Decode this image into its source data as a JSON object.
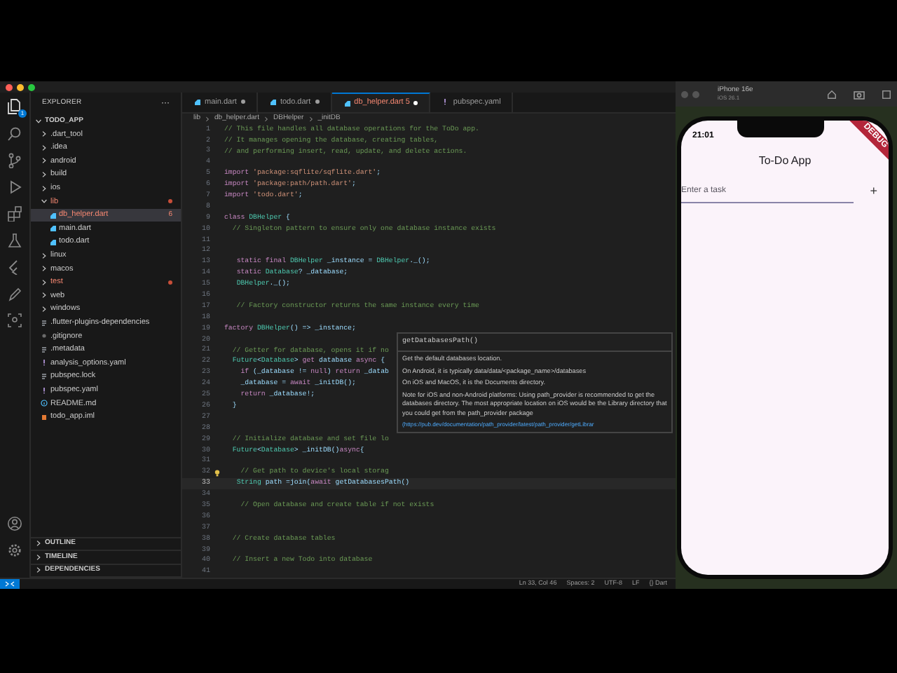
{
  "activity_bar": {
    "badge": "1"
  },
  "explorer": {
    "title": "EXPLORER",
    "more": "···",
    "root": "TODO_APP",
    "items": [
      {
        "label": ".dart_tool",
        "kind": "folder",
        "expanded": false,
        "selected": false,
        "error": false
      },
      {
        "label": ".idea",
        "kind": "folder",
        "expanded": false,
        "selected": false,
        "error": false
      },
      {
        "label": "android",
        "kind": "folder",
        "expanded": false,
        "selected": false,
        "error": false
      },
      {
        "label": "build",
        "kind": "folder",
        "expanded": false,
        "selected": false,
        "error": false
      },
      {
        "label": "ios",
        "kind": "folder",
        "expanded": false,
        "selected": false,
        "error": false
      },
      {
        "label": "lib",
        "kind": "folder",
        "expanded": true,
        "selected": false,
        "error": true,
        "children": [
          {
            "label": "db_helper.dart",
            "kind": "dart",
            "selected": true,
            "error": true,
            "badge": "6"
          },
          {
            "label": "main.dart",
            "kind": "dart",
            "selected": false,
            "error": false
          },
          {
            "label": "todo.dart",
            "kind": "dart",
            "selected": false,
            "error": false
          }
        ]
      },
      {
        "label": "linux",
        "kind": "folder",
        "expanded": false,
        "selected": false,
        "error": false
      },
      {
        "label": "macos",
        "kind": "folder",
        "expanded": false,
        "selected": false,
        "error": false
      },
      {
        "label": "test",
        "kind": "folder",
        "expanded": false,
        "selected": false,
        "error": true
      },
      {
        "label": "web",
        "kind": "folder",
        "expanded": false,
        "selected": false,
        "error": false
      },
      {
        "label": "windows",
        "kind": "folder",
        "expanded": false,
        "selected": false,
        "error": false
      },
      {
        "label": ".flutter-plugins-dependencies",
        "kind": "text",
        "selected": false,
        "error": false
      },
      {
        "label": ".gitignore",
        "kind": "git",
        "selected": false,
        "error": false
      },
      {
        "label": ".metadata",
        "kind": "text",
        "selected": false,
        "error": false
      },
      {
        "label": "analysis_options.yaml",
        "kind": "yaml",
        "selected": false,
        "error": false
      },
      {
        "label": "pubspec.lock",
        "kind": "text",
        "selected": false,
        "error": false
      },
      {
        "label": "pubspec.yaml",
        "kind": "yaml",
        "selected": false,
        "error": false
      },
      {
        "label": "README.md",
        "kind": "info",
        "selected": false,
        "error": false
      },
      {
        "label": "todo_app.iml",
        "kind": "iml",
        "selected": false,
        "error": false
      }
    ]
  },
  "sections": [
    "OUTLINE",
    "TIMELINE",
    "DEPENDENCIES"
  ],
  "tabs": [
    {
      "label": "main.dart",
      "selected": false,
      "modified": true
    },
    {
      "label": "todo.dart",
      "selected": false,
      "modified": true
    },
    {
      "label": "db_helper.dart",
      "badge": "5",
      "selected": true,
      "modified": true
    },
    {
      "label": "pubspec.yaml",
      "selected": false,
      "modified": false
    }
  ],
  "breadcrumbs": [
    "lib",
    "db_helper.dart",
    "DBHelper",
    "_initDB"
  ],
  "code_lines": [
    {
      "n": "1",
      "kind": "comment",
      "text": "// This file handles all database operations for the ToDo app."
    },
    {
      "n": "2",
      "kind": "comment",
      "text": "// It manages opening the database, creating tables,"
    },
    {
      "n": "3",
      "kind": "comment",
      "text": "// and performing insert, read, update, and delete actions."
    },
    {
      "n": "4",
      "kind": "blank"
    },
    {
      "n": "5",
      "kind": "code",
      "text": "import 'package:sqflite/sqflite.dart';"
    },
    {
      "n": "6",
      "kind": "code",
      "text": "import 'package:path/path.dart';"
    },
    {
      "n": "7",
      "kind": "code",
      "text": "import 'todo.dart';"
    },
    {
      "n": "8",
      "kind": "blank"
    },
    {
      "n": "9",
      "kind": "code",
      "text": "class DBHelper {"
    },
    {
      "n": "10",
      "kind": "comment",
      "text": "  // Singleton pattern to ensure only one database instance exists"
    },
    {
      "n": "11",
      "kind": "blank"
    },
    {
      "n": "12",
      "kind": "blank"
    },
    {
      "n": "13",
      "kind": "code",
      "text": "   static final DBHelper _instance = DBHelper._();"
    },
    {
      "n": "14",
      "kind": "code",
      "text": "   static Database? _database;"
    },
    {
      "n": "15",
      "kind": "code",
      "text": "   DBHelper._();"
    },
    {
      "n": "16",
      "kind": "blank"
    },
    {
      "n": "17",
      "kind": "comment",
      "text": "   // Factory constructor returns the same instance every time"
    },
    {
      "n": "18",
      "kind": "blank"
    },
    {
      "n": "19",
      "kind": "code",
      "text": "factory DBHelper() => _instance;"
    },
    {
      "n": "20",
      "kind": "blank"
    },
    {
      "n": "21",
      "kind": "comment",
      "text": "  // Getter for database, opens it if no"
    },
    {
      "n": "22",
      "kind": "code",
      "text": "  Future<Database> get database async {"
    },
    {
      "n": "23",
      "kind": "code",
      "text": "    if (_database != null) return _datab"
    },
    {
      "n": "24",
      "kind": "code",
      "text": "    _database = await _initDB();"
    },
    {
      "n": "25",
      "kind": "code",
      "text": "    return _database!;"
    },
    {
      "n": "26",
      "kind": "code",
      "text": "  }"
    },
    {
      "n": "27",
      "kind": "blank"
    },
    {
      "n": "28",
      "kind": "blank"
    },
    {
      "n": "29",
      "kind": "comment",
      "text": "  // Initialize database and set file lo"
    },
    {
      "n": "30",
      "kind": "code",
      "text": "  Future<Database> _initDB()async{"
    },
    {
      "n": "31",
      "kind": "blank"
    },
    {
      "n": "32",
      "kind": "comment",
      "text": "    // Get path to device's local storag"
    },
    {
      "n": "33",
      "kind": "code",
      "text": "   String path =join(await getDatabasesPath()"
    },
    {
      "n": "34",
      "kind": "blank"
    },
    {
      "n": "35",
      "kind": "comment",
      "text": "    // Open database and create table if not exists"
    },
    {
      "n": "36",
      "kind": "blank"
    },
    {
      "n": "37",
      "kind": "blank"
    },
    {
      "n": "38",
      "kind": "comment",
      "text": "  // Create database tables"
    },
    {
      "n": "39",
      "kind": "blank"
    },
    {
      "n": "40",
      "kind": "comment",
      "text": "  // Insert a new Todo into database"
    },
    {
      "n": "41",
      "kind": "blank"
    }
  ],
  "tooltip": {
    "signature": "getDatabasesPath()",
    "paragraphs": [
      "Get the default databases location.",
      "On Android, it is typically data/data/<package_name>/databases",
      "On iOS and MacOS, it is the Documents directory.",
      "Note for iOS and non-Android platforms: Using path_provider is recommended to get the databases directory. The most appropriate location on iOS would be the Library directory that you could get from the path_provider package"
    ],
    "link": "(https://pub.dev/documentation/path_provider/latest/path_provider/getLibrar"
  },
  "status_bar": [
    "Ln 33, Col 46",
    "Spaces: 2",
    "UTF-8",
    "LF",
    "{} Dart"
  ],
  "simulator": {
    "device": "iPhone 16e",
    "os": "iOS 26.1",
    "time": "21:01",
    "banner": "DEBUG",
    "app_title": "To-Do App",
    "input": {
      "placeholder": "Enter a task"
    },
    "add_button": "+"
  }
}
